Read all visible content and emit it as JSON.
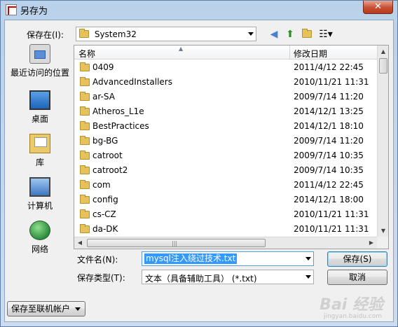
{
  "window": {
    "title": "另存为",
    "close_label": "✕"
  },
  "toolbar": {
    "save_in_label": "保存在(I):",
    "location": "System32",
    "back_icon": "back-arrow-icon",
    "up_icon": "up-folder-icon",
    "new_folder_icon": "new-folder-icon",
    "view_menu_icon": "view-menu-icon"
  },
  "places": [
    {
      "label": "最近访问的位置",
      "icon": "recent-places-icon"
    },
    {
      "label": "桌面",
      "icon": "desktop-icon"
    },
    {
      "label": "库",
      "icon": "libraries-icon"
    },
    {
      "label": "计算机",
      "icon": "computer-icon"
    },
    {
      "label": "网络",
      "icon": "network-icon"
    }
  ],
  "file_list": {
    "columns": [
      "名称",
      "修改日期"
    ],
    "rows": [
      {
        "name": "0409",
        "date": "2011/4/12 22:45"
      },
      {
        "name": "AdvancedInstallers",
        "date": "2010/11/21 11:31"
      },
      {
        "name": "ar-SA",
        "date": "2009/7/14 11:20"
      },
      {
        "name": "Atheros_L1e",
        "date": "2014/12/1 13:25"
      },
      {
        "name": "BestPractices",
        "date": "2014/12/1 18:10"
      },
      {
        "name": "bg-BG",
        "date": "2009/7/14 11:20"
      },
      {
        "name": "catroot",
        "date": "2009/7/14 10:35"
      },
      {
        "name": "catroot2",
        "date": "2009/7/14 10:35"
      },
      {
        "name": "com",
        "date": "2011/4/12 22:45"
      },
      {
        "name": "config",
        "date": "2014/12/1 18:00"
      },
      {
        "name": "cs-CZ",
        "date": "2010/11/21 11:31"
      },
      {
        "name": "da-DK",
        "date": "2010/11/21 11:31"
      }
    ]
  },
  "form": {
    "filename_label": "文件名(N):",
    "filename_value": "mysql注入绕过技术.txt",
    "filetype_label": "保存类型(T):",
    "filetype_value": "文本（具备辅助工具） (*.txt)",
    "save_button": "保存(S)",
    "cancel_button": "取消",
    "save_to_account": "保存至联机帐户"
  },
  "watermark": {
    "brand": "Bai 经验",
    "url": "jingyan.baidu.com"
  }
}
